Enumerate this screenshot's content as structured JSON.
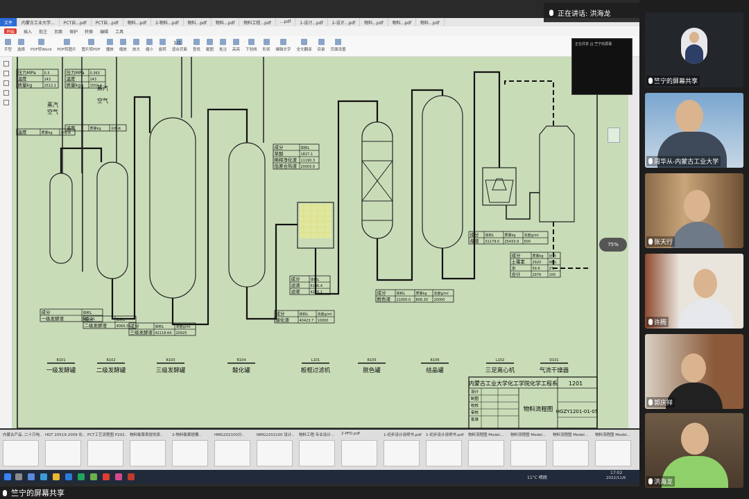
{
  "meeting": {
    "speaking_label": "正在讲话: 洪海龙",
    "screen_share_label": "竺宁的屏幕共享",
    "share_overlay_text": "正在共享 ||| 竺宁的屏幕"
  },
  "browser_tabs": [
    "文件",
    "内蒙古工业大学...",
    "PCT自...pdf",
    "PCT自...pdf",
    "物料...pdf",
    "2-物料...pdf",
    "物料...pdf",
    "物料...pdf",
    "物料工程...pdf",
    "...pdf",
    "1-设计...pdf",
    "2-设计...pdf",
    "物料...pdf",
    "物料...pdf",
    "物料...pdf"
  ],
  "menu": [
    "开始",
    "插入",
    "批注",
    "页面",
    "保护",
    "转换",
    "编辑",
    "工具"
  ],
  "menu_active": "开始",
  "ribbon": [
    "手型",
    "选择",
    "PDF转Word",
    "PDF转图片",
    "图片转PDF",
    "播放",
    "缩放",
    "放大",
    "缩小",
    "旋转",
    "适合页面",
    "查找",
    "截图",
    "批注",
    "高亮",
    "下划线",
    "形状",
    "编辑文字",
    "全文翻译",
    "目录",
    "页面设置"
  ],
  "page_count": "1/1",
  "zoom": "75%",
  "drawing": {
    "equipment_labels": [
      "一级发酵罐",
      "二级发酵罐",
      "三级发酵罐",
      "酸化罐",
      "板框过滤机",
      "脱色罐",
      "结晶罐",
      "三足离心机",
      "气流干燥器"
    ],
    "equipment_tags": [
      "R101",
      "R102",
      "R103",
      "R104",
      "L101",
      "R105",
      "R106",
      "L102",
      "D101"
    ],
    "stream_words": [
      "蒸汽",
      "空气",
      "蒸汽",
      "空气",
      "冷却水",
      "冷却水"
    ],
    "table1": {
      "rows": [
        [
          "压力MPa",
          "0.3"
        ],
        [
          "温度",
          "143"
        ],
        [
          "质量kg",
          "1512.1"
        ]
      ]
    },
    "table2": {
      "rows": [
        [
          "压力MPa",
          "0.363"
        ],
        [
          "温度",
          "143"
        ],
        [
          "质量kg",
          "1502.1"
        ]
      ]
    },
    "table3": {
      "rows": [
        [
          "温度",
          "质量kg",
          "冷却水"
        ]
      ]
    },
    "table4": {
      "rows": [
        [
          "温度",
          "质量kg",
          "冷却水"
        ]
      ]
    },
    "table5": {
      "rows": [
        [
          "成分",
          "体积L"
        ],
        [
          "一级发酵液",
          "451.11"
        ]
      ]
    },
    "table6": {
      "rows": [
        [
          "成分",
          "体积L"
        ],
        [
          "二级发酵液",
          "4064.31"
        ]
      ]
    },
    "table7": {
      "rows": [
        [
          "成分",
          "体积L",
          "浓度g/ml"
        ],
        [
          "三级发酵液",
          "42118.64",
          "20925"
        ]
      ]
    },
    "table8": {
      "rows": [
        [
          "成分",
          "体积L"
        ],
        [
          "草酸",
          "1827.1"
        ],
        [
          "稀释净化液",
          "11190.3"
        ],
        [
          "低差合热液",
          "20005.6"
        ]
      ]
    },
    "table9": {
      "rows": [
        [
          "成分",
          "体积L"
        ],
        [
          "滤渣",
          "6106.4"
        ],
        [
          "滤液",
          "4226.1"
        ]
      ]
    },
    "table10": {
      "rows": [
        [
          "成分",
          "体积L",
          "浓度g/ml"
        ],
        [
          "酸化液",
          "40423.7",
          "10000"
        ]
      ]
    },
    "table11": {
      "rows": [
        [
          "成分",
          "体积L",
          "质量kg",
          "浓度g/ml"
        ],
        [
          "脱色液",
          "21000.0",
          "806.30",
          "10000"
        ]
      ]
    },
    "table12": {
      "rows": [
        [
          "成分",
          "体积L",
          "质量kg",
          "浓度g/ml"
        ],
        [
          "母液",
          "31179.0",
          "25433.9",
          "500"
        ]
      ]
    },
    "table13": {
      "rows": [
        [
          "成分",
          "质量kg",
          "比例"
        ],
        [
          "土霉素",
          "2920",
          "98%"
        ],
        [
          "水",
          "59.6",
          "2%"
        ],
        [
          "合计",
          "2979",
          "100"
        ]
      ]
    },
    "title_block": {
      "school": "内蒙古工业大学化工学院化学工程系",
      "drawing_name": "物料流程图",
      "drawing_no": "HGZY1201-01-05",
      "sheet": "1201",
      "roles": [
        "设计",
        "制图",
        "校核",
        "审核",
        "批准"
      ]
    }
  },
  "thumbnails": [
    "内蒙古产品..二十万吨..",
    "HGT 20519-2009 化..",
    "PCT工艺流程图 P202..",
    "物料衡算表提供资..",
    "2-物料衡算提要..",
    "HMG202100分..",
    "NMG2202100 设计..",
    "物料工程·专业设计·..",
    "2-PFD.pdf",
    "1-初步设计说明书.pdf",
    "1-初步设计说明书.pdf",
    "物料流程图 Model...",
    "物料流程图 Model...",
    "物料流程图 Model...",
    "物料流程图 Model..."
  ],
  "taskbar": {
    "weather": "11°C 晴朗",
    "time": "17:02",
    "date": "2022/11/6"
  },
  "participants": [
    {
      "name": "竺宁的屏幕共享"
    },
    {
      "name": "周华从-内蒙古工业大学"
    },
    {
      "name": "张天行"
    },
    {
      "name": "许腾"
    },
    {
      "name": "郭庆祥"
    },
    {
      "name": "洪海龙"
    }
  ],
  "colors": {
    "drawing_bg": "#c9dcb8",
    "accent": "#e03c31",
    "tab_active": "#2b6bd6"
  }
}
